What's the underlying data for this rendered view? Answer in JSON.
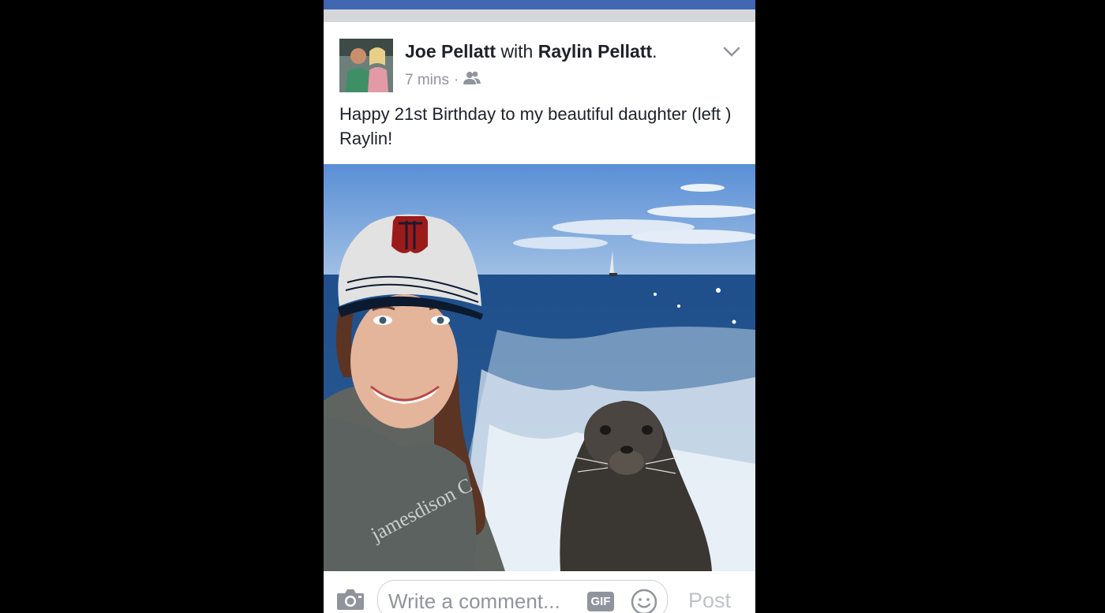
{
  "post": {
    "author": "Joe Pellatt",
    "with_word": "with",
    "tagged": "Raylin Pellatt",
    "period": ".",
    "time": "7 mins",
    "dot": "·",
    "audience_icon": "friends-icon",
    "text": "Happy 21st Birthday to my beautiful daughter (left ) Raylin!"
  },
  "photo": {
    "shirt_text": "jamesdison C"
  },
  "composer": {
    "placeholder": "Write a comment...",
    "gif_label": "GIF",
    "post_label": "Post",
    "camera_icon": "camera-icon",
    "emoji_icon": "smiley-icon"
  },
  "colors": {
    "brand": "#4267b2",
    "meta": "#90949c",
    "text": "#1d2129"
  }
}
